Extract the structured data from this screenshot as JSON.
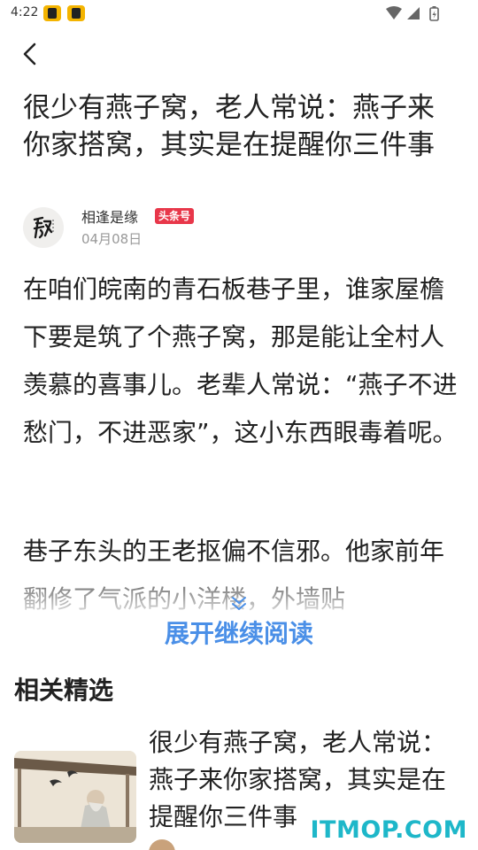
{
  "status_bar": {
    "time": "4:22"
  },
  "article": {
    "title": "很少有燕子窝，老人常说：燕子来你家搭窝，其实是在提醒你三件事",
    "author": {
      "name": "相逢是缘",
      "badge": "头条号",
      "date": "04月08日"
    },
    "paragraphs": [
      "在咱们皖南的青石板巷子里，谁家屋檐下要是筑了个燕子窝，那是能让全村人羡慕的喜事儿。老辈人常说：“燕子不进愁门，不进恶家”，这小东西眼毒着呢。",
      "巷子东头的王老抠偏不信邪。他家前年翻修了气派的小洋楼，外墙贴"
    ]
  },
  "expand": {
    "label": "展开继续阅读"
  },
  "related": {
    "section_title": "相关精选",
    "items": [
      {
        "title": "很少有燕子窝，老人常说：燕子来你家搭窝，其实是在提醒你三件事"
      }
    ]
  },
  "watermark": {
    "text": "ITMOP.COM"
  },
  "colors": {
    "accent": "#4a8fe7",
    "badge": "#e8374a",
    "watermark": "#1eb7c9"
  }
}
